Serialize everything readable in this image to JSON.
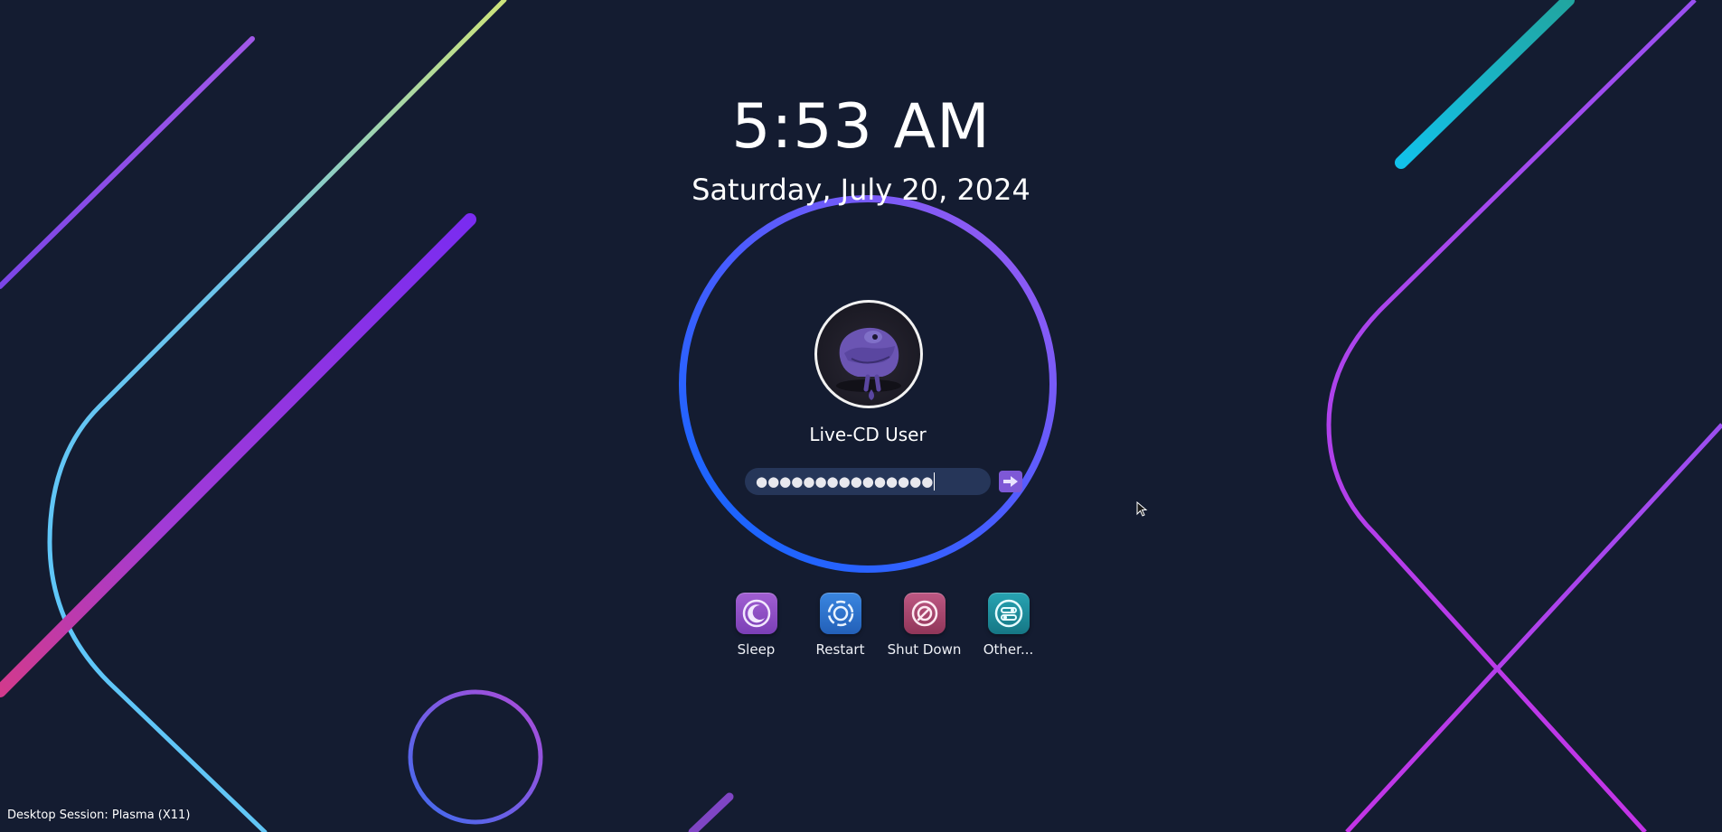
{
  "clock": {
    "time": "5:53 AM",
    "date": "Saturday, July 20, 2024"
  },
  "user": {
    "name": "Live-CD User",
    "avatar_icon": "chameleon-avatar-icon"
  },
  "password": {
    "masked_value": "●●●●●●●●●●●●●●●",
    "login_icon": "arrow-right-icon"
  },
  "actions": [
    {
      "label": "Sleep",
      "icon": "sleep-icon",
      "color": "#8b4fc4"
    },
    {
      "label": "Restart",
      "icon": "restart-icon",
      "color": "#2a6fc9"
    },
    {
      "label": "Shut Down",
      "icon": "shutdown-icon",
      "color": "#a8446e"
    },
    {
      "label": "Other...",
      "icon": "other-icon",
      "color": "#1d8a9a"
    }
  ],
  "session": {
    "label": "Desktop Session: Plasma (X11)"
  },
  "colors": {
    "background": "#141c31",
    "ring_blue": "#1565ff",
    "ring_violet": "#9a55f0",
    "accent_purple": "#7e58d6"
  }
}
